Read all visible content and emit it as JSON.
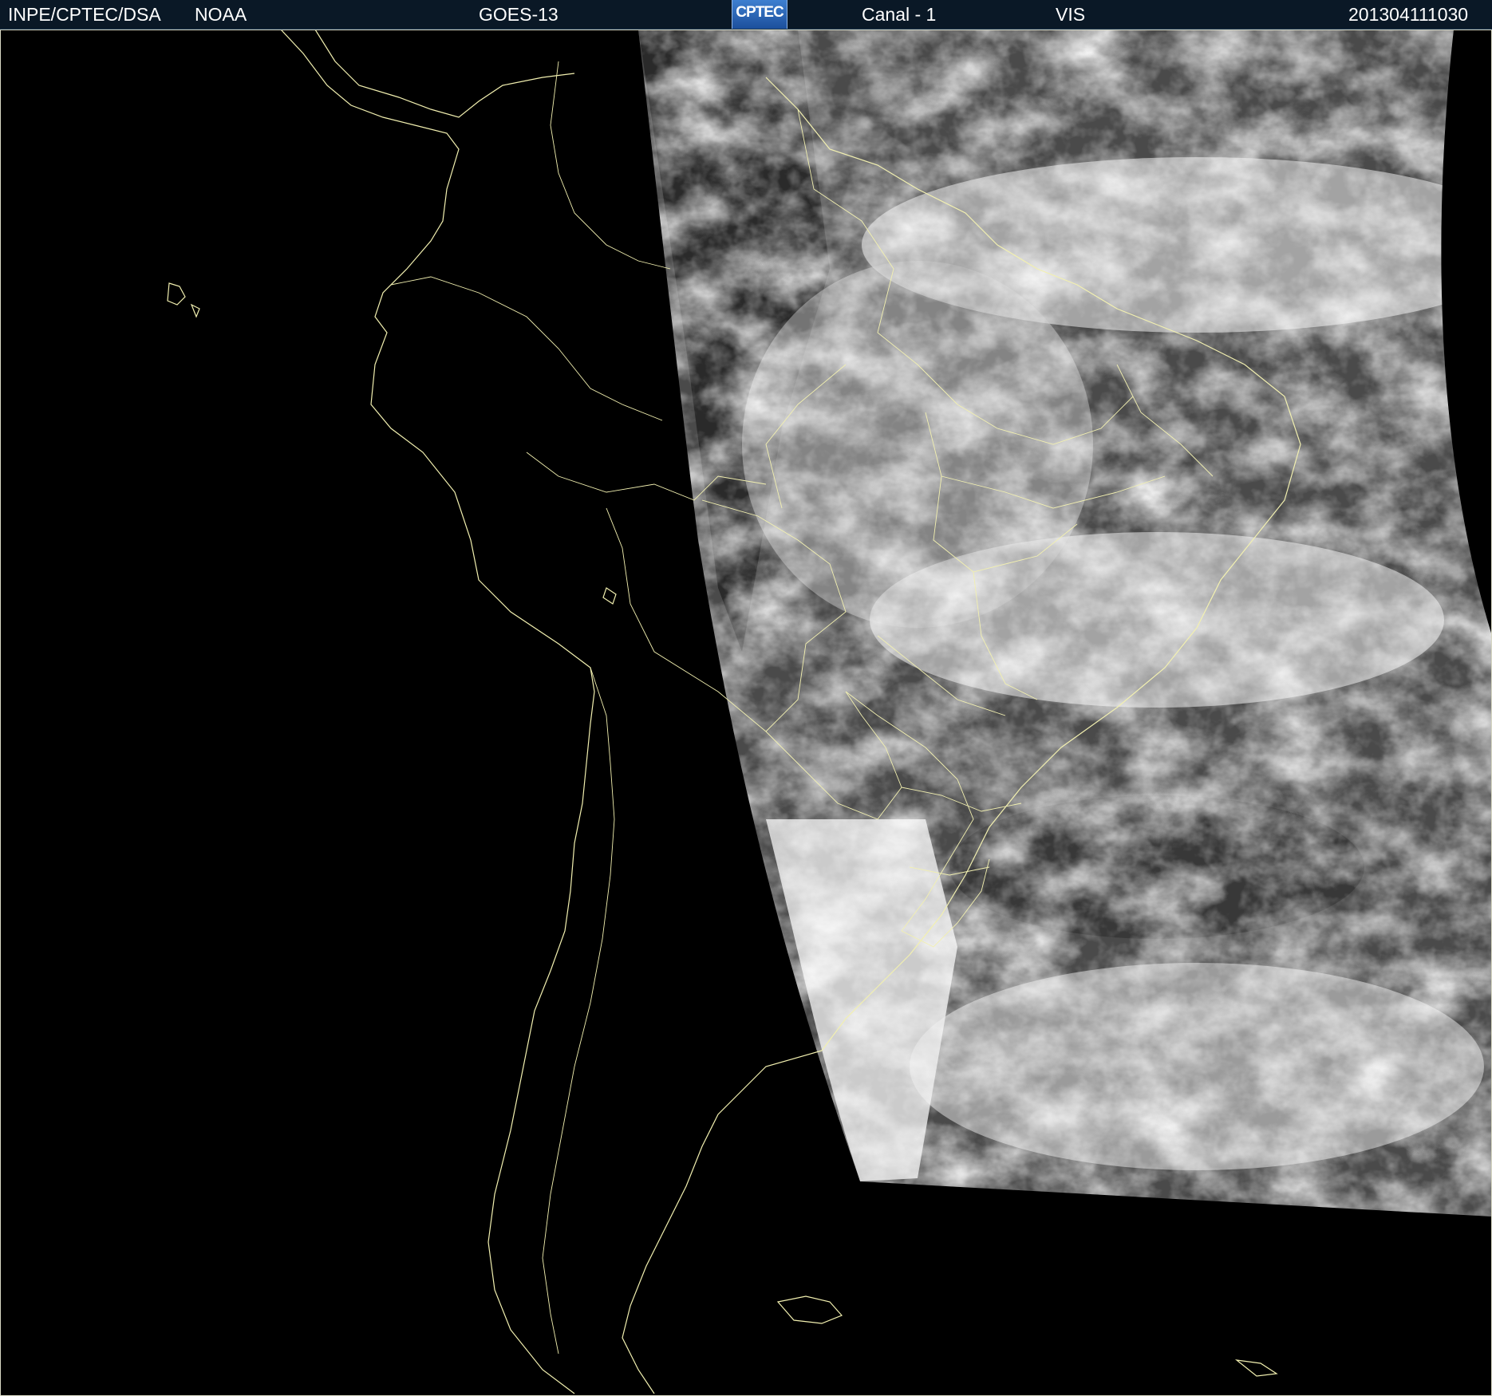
{
  "header": {
    "institution": "INPE/CPTEC/DSA",
    "agency": "NOAA",
    "satellite": "GOES-13",
    "logo_text": "CPTEC",
    "channel": "Canal - 1",
    "band": "VIS",
    "timestamp": "201304111030"
  },
  "map": {
    "coastline_color": "#f2f0b0",
    "border_color": "#f2f0b0",
    "background_color": "#000000",
    "cloud_base_color": "#4a4a4a",
    "cloud_bright_color": "#ececec"
  }
}
